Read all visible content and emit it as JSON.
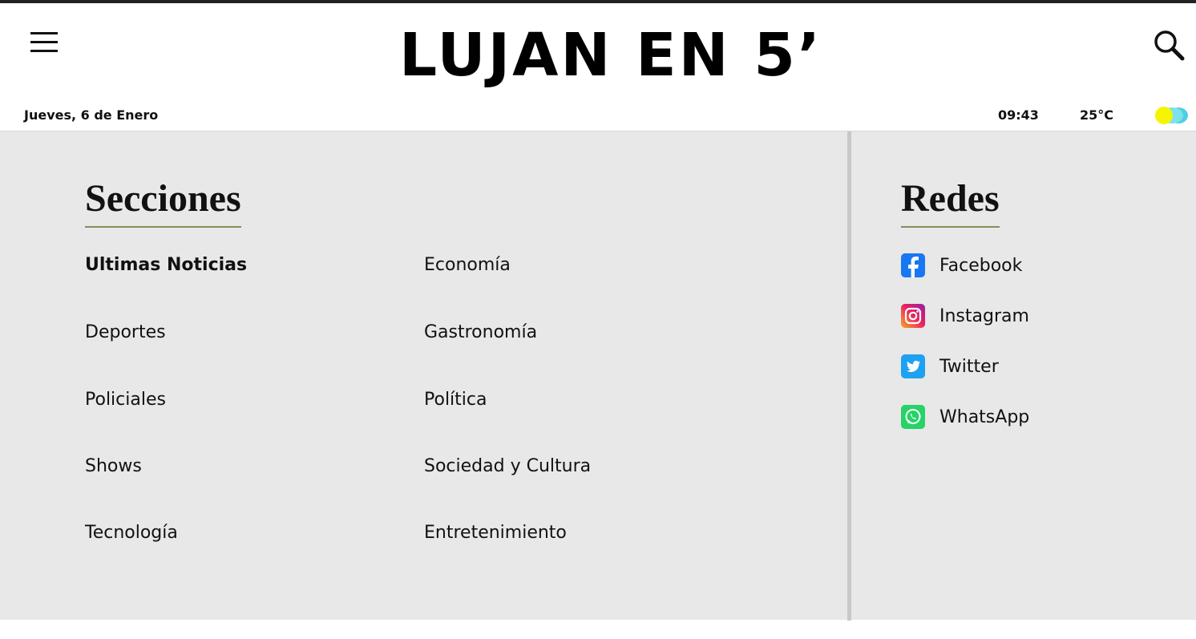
{
  "header": {
    "logo_text": "LUJAN EN 5’"
  },
  "info_bar": {
    "date": "Jueves, 6 de Enero",
    "time": "09:43",
    "temperature": "25°C",
    "weather_icon": "sun-cloud-icon"
  },
  "sections": {
    "title": "Secciones",
    "column_1": [
      "Ultimas Noticias",
      "Deportes",
      "Policiales",
      "Shows",
      "Tecnología"
    ],
    "column_2": [
      "Economía",
      "Gastronomía",
      "Política",
      "Sociedad y Cultura",
      "Entretenimiento"
    ]
  },
  "social": {
    "title": "Redes",
    "items": [
      {
        "label": "Facebook",
        "icon": "facebook-icon",
        "color": "#1877f2"
      },
      {
        "label": "Instagram",
        "icon": "instagram-icon",
        "color": "#d6249f"
      },
      {
        "label": "Twitter",
        "icon": "twitter-icon",
        "color": "#1da1f2"
      },
      {
        "label": "WhatsApp",
        "icon": "whatsapp-icon",
        "color": "#25d366"
      }
    ]
  },
  "colors": {
    "panel_bg": "#e8e8e8",
    "heading_underline": "#8a8a5c",
    "top_border": "#222222"
  }
}
